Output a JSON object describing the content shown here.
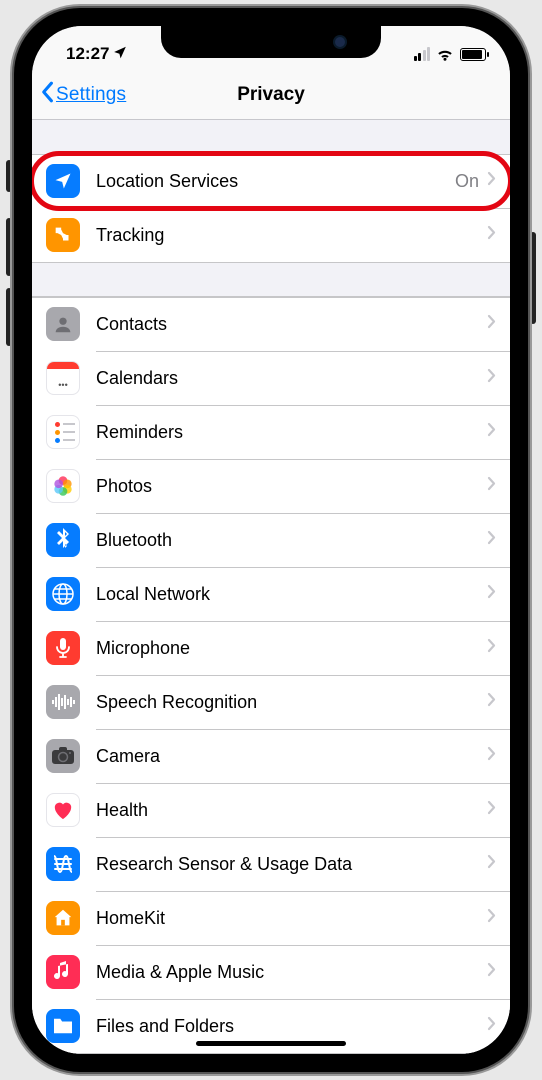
{
  "status": {
    "time": "12:27"
  },
  "nav": {
    "back_label": "Settings",
    "title": "Privacy"
  },
  "section1": [
    {
      "key": "location",
      "label": "Location Services",
      "value": "On",
      "highlight": true
    },
    {
      "key": "tracking",
      "label": "Tracking"
    }
  ],
  "section2": [
    {
      "key": "contacts",
      "label": "Contacts"
    },
    {
      "key": "calendars",
      "label": "Calendars"
    },
    {
      "key": "reminders",
      "label": "Reminders"
    },
    {
      "key": "photos",
      "label": "Photos"
    },
    {
      "key": "bluetooth",
      "label": "Bluetooth"
    },
    {
      "key": "localnet",
      "label": "Local Network"
    },
    {
      "key": "mic",
      "label": "Microphone"
    },
    {
      "key": "speech",
      "label": "Speech Recognition"
    },
    {
      "key": "camera",
      "label": "Camera"
    },
    {
      "key": "health",
      "label": "Health"
    },
    {
      "key": "research",
      "label": "Research Sensor & Usage Data"
    },
    {
      "key": "homekit",
      "label": "HomeKit"
    },
    {
      "key": "media",
      "label": "Media & Apple Music"
    },
    {
      "key": "files",
      "label": "Files and Folders"
    }
  ]
}
